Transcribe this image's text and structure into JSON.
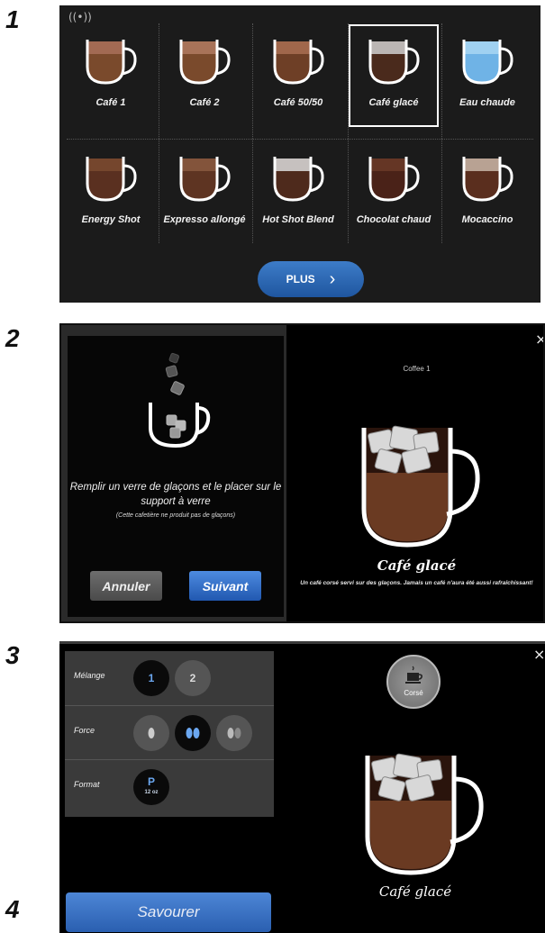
{
  "steps": [
    "1",
    "2",
    "3",
    "4"
  ],
  "menu": {
    "drinks": [
      {
        "label": "Café 1",
        "fill": "#7a4a2c",
        "top": "#a9705a"
      },
      {
        "label": "Café 2",
        "fill": "#7a4a2c",
        "top": "#b07a62"
      },
      {
        "label": "Café 50/50",
        "fill": "#6e3f26",
        "top": "#a96f52"
      },
      {
        "label": "Café glacé",
        "fill": "#4a2a1c",
        "top": "#cfcfcf"
      },
      {
        "label": "Eau chaude",
        "fill": "#6fb3e6",
        "top": "#a9d6f2"
      },
      {
        "label": "Energy Shot",
        "fill": "#5a3020",
        "top": "#7a4a30"
      },
      {
        "label": "Expresso allongé",
        "fill": "#5e3422",
        "top": "#8a5a40"
      },
      {
        "label": "Hot Shot Blend",
        "fill": "#4e2a1c",
        "top": "#dcdcdc"
      },
      {
        "label": "Chocolat chaud",
        "fill": "#4a2218",
        "top": "#6a3a28"
      },
      {
        "label": "Mocaccino",
        "fill": "#5a2e1e",
        "top": "#c9b6a8"
      }
    ],
    "selected_label": "Café glacé",
    "more_button": "PLUS",
    "more_chevron": "›"
  },
  "dialog": {
    "instruction": "Remplir un verre de glaçons et le placer sur le support à verre",
    "note": "(Cette cafetière ne produit pas de glaçons)",
    "cancel": "Annuler",
    "next": "Suivant",
    "coffee_label": "Coffee 1",
    "drink_name": "Café glacé",
    "description": "Un café corsé servi sur des glaçons. Jamais un café n'aura été aussi rafraîchissant!",
    "close": "×"
  },
  "customize": {
    "rows": [
      {
        "label": "Mélange",
        "options": [
          "1",
          "2"
        ],
        "selected": 0
      },
      {
        "label": "Force",
        "options": [
          "◖",
          "◖◗",
          "◖◗"
        ],
        "selected": 1
      },
      {
        "label": "Format",
        "options": [
          "P"
        ],
        "selected": 0,
        "sub": "12 oz"
      }
    ],
    "strength_badge": "Corsé",
    "drink_name": "Café glacé",
    "confirm": "Savourer",
    "close": "×"
  }
}
